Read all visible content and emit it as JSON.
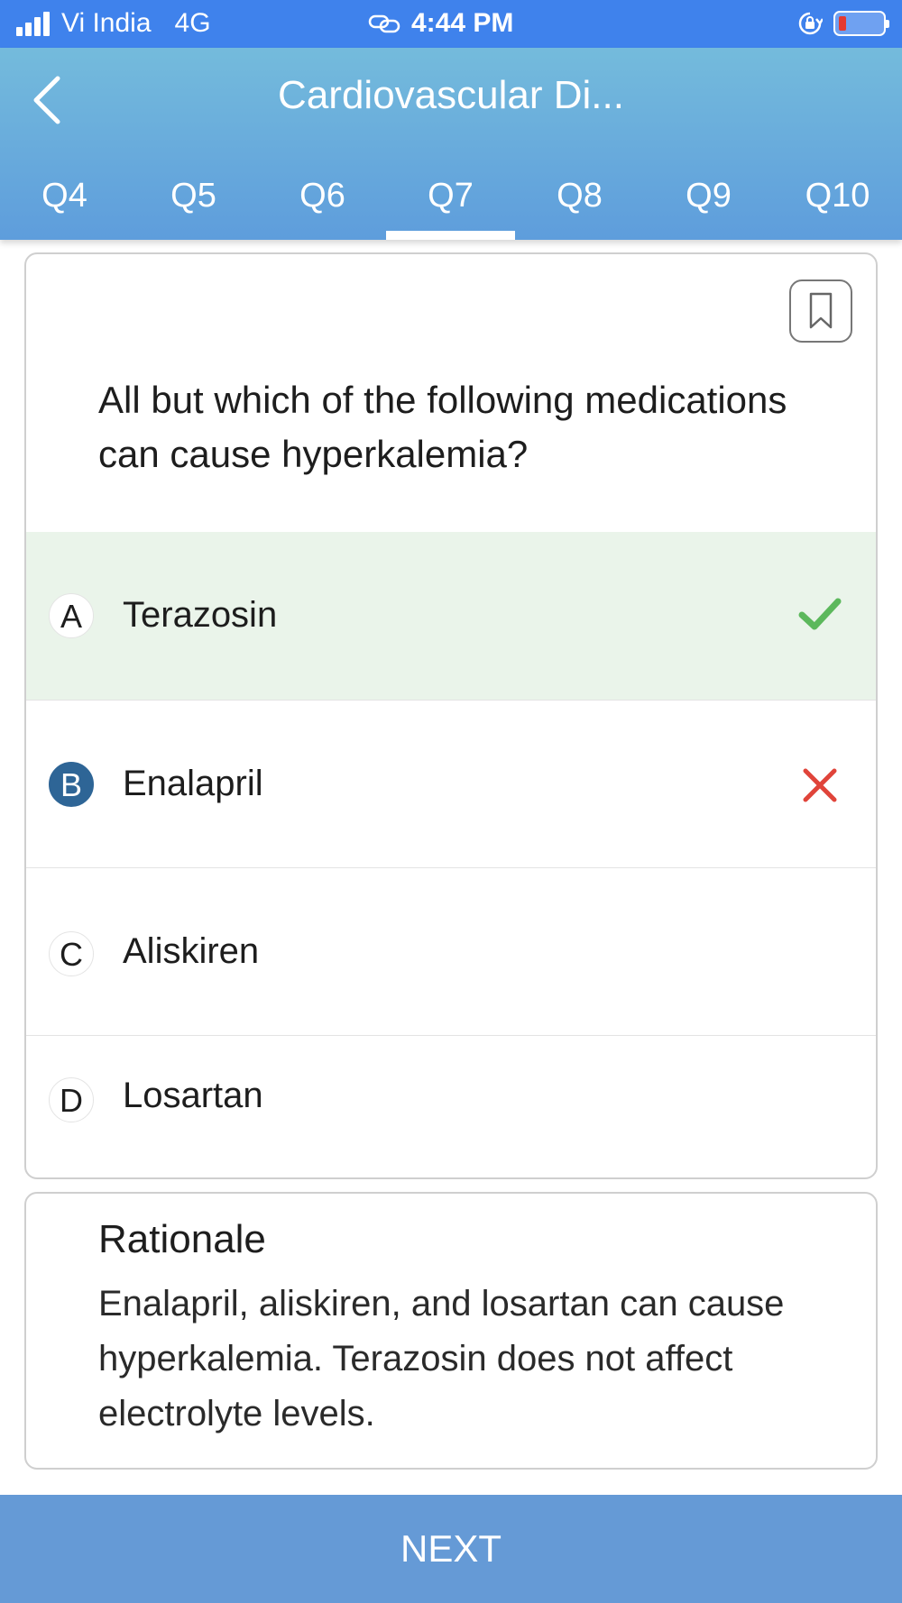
{
  "status_bar": {
    "carrier": "Vi India",
    "network": "4G",
    "time": "4:44 PM",
    "battery_color": "#e43a30"
  },
  "header": {
    "back_icon": "chevron-left-icon",
    "title": "Cardiovascular Di..."
  },
  "tabs": [
    {
      "label": "Q4",
      "active": false
    },
    {
      "label": "Q5",
      "active": false
    },
    {
      "label": "Q6",
      "active": false
    },
    {
      "label": "Q7",
      "active": true
    },
    {
      "label": "Q8",
      "active": false
    },
    {
      "label": "Q9",
      "active": false
    },
    {
      "label": "Q10",
      "active": false
    }
  ],
  "question": {
    "bookmark_icon": "bookmark-icon",
    "text": "All but which of the following medications can cause hyperkalemia?",
    "options": [
      {
        "letter": "A",
        "text": "Terazosin",
        "state": "correct",
        "icon": "check-icon"
      },
      {
        "letter": "B",
        "text": "Enalapril",
        "state": "selected-wrong",
        "icon": "cross-icon"
      },
      {
        "letter": "C",
        "text": "Aliskiren",
        "state": "none"
      },
      {
        "letter": "D",
        "text": "Losartan",
        "state": "none"
      }
    ]
  },
  "rationale": {
    "title": "Rationale",
    "body": "Enalapril, aliskiren, and losartan can cause hyperkalemia. Terazosin does not affect electrolyte levels."
  },
  "footer": {
    "next_label": "NEXT"
  },
  "colors": {
    "status_bar": "#3f82ec",
    "header_top": "#74bbdc",
    "header_bottom": "#5e9ddc",
    "correct_bg": "#eaf4ea",
    "check": "#5cb85c",
    "cross": "#e0443a",
    "selected_badge": "#2e6596",
    "next_button": "#659ad6"
  }
}
